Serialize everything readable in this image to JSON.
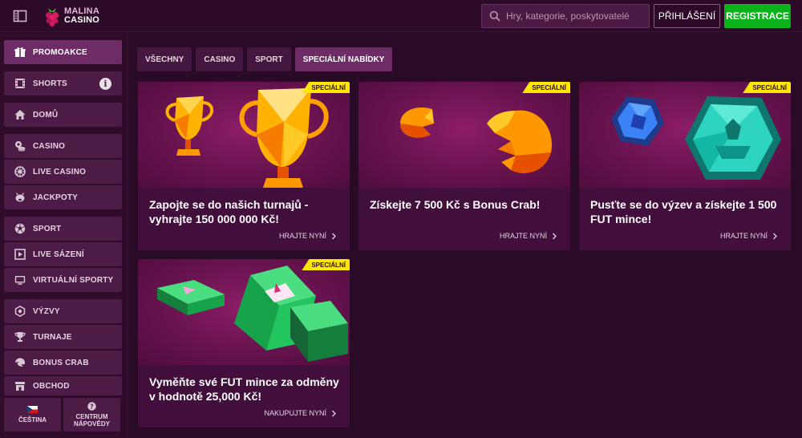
{
  "header": {
    "logo": {
      "line1": "MALINA",
      "line2": "CASINO"
    },
    "search": {
      "placeholder": "Hry, kategorie, poskytovatelé"
    },
    "login_label": "PŘIHLÁŠENÍ",
    "register_label": "REGISTRACE",
    "colors": {
      "register": "#0bb31a",
      "background": "#2c0a28"
    }
  },
  "sidebar": {
    "items": [
      {
        "label": "PROMOAKCE",
        "icon": "gift-icon",
        "active": true
      },
      {
        "label": "SHORTS",
        "icon": "film-icon",
        "info": "i"
      },
      {
        "label": "DOMŮ",
        "icon": "home-icon"
      },
      {
        "label": "CASINO",
        "icon": "casino-chips-icon"
      },
      {
        "label": "LIVE CASINO",
        "icon": "roulette-icon"
      },
      {
        "label": "JACKPOTY",
        "icon": "jackpot-pig-icon"
      },
      {
        "label": "SPORT",
        "icon": "soccer-ball-icon"
      },
      {
        "label": "LIVE SÁZENÍ",
        "icon": "live-scoreboard-icon"
      },
      {
        "label": "VIRTUÁLNÍ SPORTY",
        "icon": "virtual-screen-icon"
      },
      {
        "label": "VÝZVY",
        "icon": "challenge-badge-icon"
      },
      {
        "label": "TURNAJE",
        "icon": "trophy-icon"
      },
      {
        "label": "BONUS CRAB",
        "icon": "crab-claw-icon"
      },
      {
        "label": "OBCHOD",
        "icon": "shop-icon"
      }
    ],
    "footer": {
      "language": {
        "label": "ČEŠTINA",
        "icon": "czech-flag-icon"
      },
      "help": {
        "line1": "CENTRUM",
        "line2": "NÁPOVĚDY",
        "icon": "help-icon"
      }
    }
  },
  "main": {
    "tabs": [
      {
        "label": "VŠECHNY"
      },
      {
        "label": "CASINO"
      },
      {
        "label": "SPORT"
      },
      {
        "label": "SPECIÁLNÍ NABÍDKY",
        "active": true
      }
    ],
    "cards": [
      {
        "badge": "SPECIÁLNÍ",
        "title": "Zapojte se do našich turnajů - vyhrajte 150 000 000 Kč!",
        "cta": "HRAJTE NYNÍ",
        "art": "trophies-art"
      },
      {
        "badge": "SPECIÁLNÍ",
        "title": "Získejte 7 500 Kč s Bonus Crab!",
        "cta": "HRAJTE NYNÍ",
        "art": "crab-claws-art"
      },
      {
        "badge": "SPECIÁLNÍ",
        "title": "Pusťte se do výzev a získejte 1 500 FUT mince!",
        "cta": "HRAJTE NYNÍ",
        "art": "gem-coins-art"
      },
      {
        "badge": "SPECIÁLNÍ",
        "title": "Vyměňte své FUT mince za odměny v hodnotě 25,000 Kč!",
        "cta": "NAKUPUJTE NYNÍ",
        "art": "cash-stacks-art"
      }
    ],
    "colors": {
      "badge": "#ffe700",
      "card": "#420f3c",
      "active": "#6e2c66"
    }
  }
}
